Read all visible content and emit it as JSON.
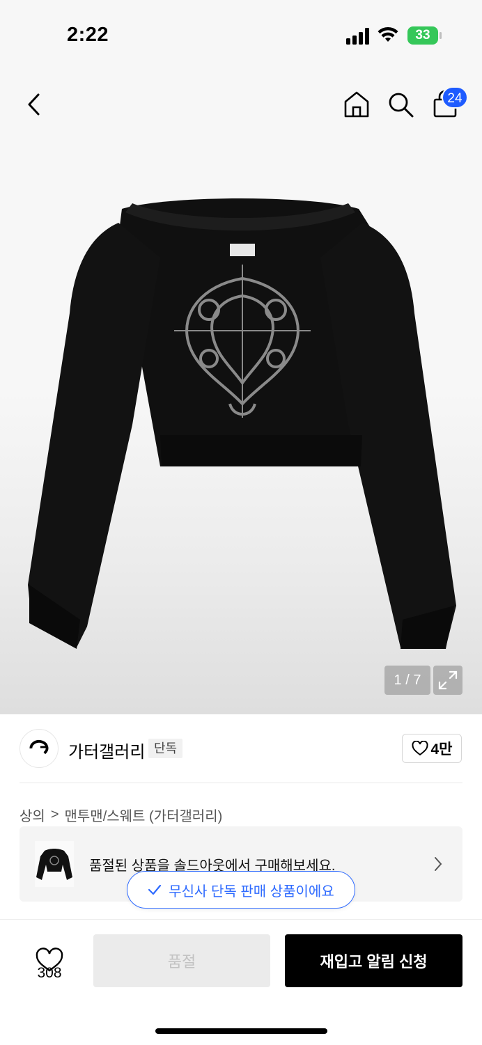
{
  "status_bar": {
    "time": "2:22",
    "battery": "33"
  },
  "nav": {
    "cart_badge": "24"
  },
  "gallery": {
    "counter": "1 / 7"
  },
  "brand": {
    "name": "가터갤러리",
    "tag": "단독",
    "likes": "4만"
  },
  "breadcrumb": {
    "category": "상의",
    "separator": ">",
    "subcategory": "맨투맨/스웨트 (가터갤러리)"
  },
  "soldout_banner": {
    "text": "품절된 상품을 솔드아웃에서 구매해보세요."
  },
  "exclusive": {
    "label": "무신사 단독 판매 상품이에요"
  },
  "bottom": {
    "wish_count": "308",
    "soldout_label": "품절",
    "restock_label": "재입고 알림 신청"
  },
  "icons": {
    "status": [
      "signal-icon",
      "wifi-icon",
      "battery-icon"
    ],
    "nav": [
      "back-icon",
      "home-icon",
      "search-icon",
      "cart-icon"
    ],
    "gallery": [
      "expand-icon"
    ],
    "misc": [
      "heart-icon",
      "chevron-right-icon",
      "check-icon"
    ]
  },
  "colors": {
    "accent_blue": "#1e5bff",
    "battery_green": "#35c759",
    "primary_button": "#000000",
    "disabled_button": "#ebebeb"
  }
}
